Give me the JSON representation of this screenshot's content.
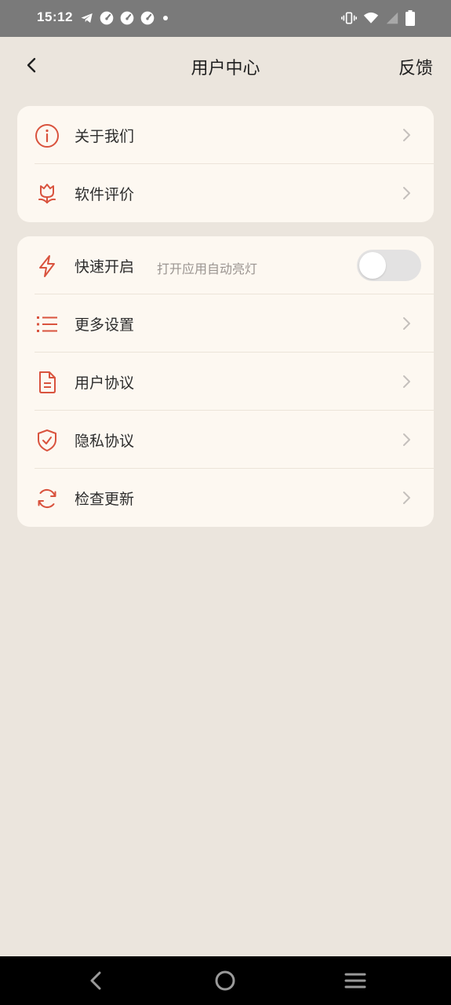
{
  "status_bar": {
    "time": "15:12",
    "left_icons": [
      "telegram-icon",
      "speedometer-icon",
      "speedometer-icon",
      "speedometer-icon",
      "dot-icon"
    ],
    "right_icons": [
      "vibrate-icon",
      "wifi-icon",
      "signal-icon",
      "battery-icon"
    ]
  },
  "header": {
    "title": "用户中心",
    "feedback_label": "反馈"
  },
  "colors": {
    "accent": "#d9533e",
    "background": "#ebe5dd",
    "card": "#fdf8f1",
    "status_bar": "#7a7a7a"
  },
  "section1": {
    "items": [
      {
        "label": "关于我们",
        "icon": "info-icon"
      },
      {
        "label": "软件评价",
        "icon": "flower-icon"
      }
    ]
  },
  "section2": {
    "quick_start": {
      "label": "快速开启",
      "subtitle": "打开应用自动亮灯",
      "icon": "lightning-icon",
      "enabled": false
    },
    "items": [
      {
        "label": "更多设置",
        "icon": "list-icon"
      },
      {
        "label": "用户协议",
        "icon": "document-icon"
      },
      {
        "label": "隐私协议",
        "icon": "shield-check-icon"
      },
      {
        "label": "检查更新",
        "icon": "refresh-icon"
      }
    ]
  },
  "nav_bar": {
    "buttons": [
      "back-icon",
      "home-icon",
      "menu-icon"
    ]
  }
}
